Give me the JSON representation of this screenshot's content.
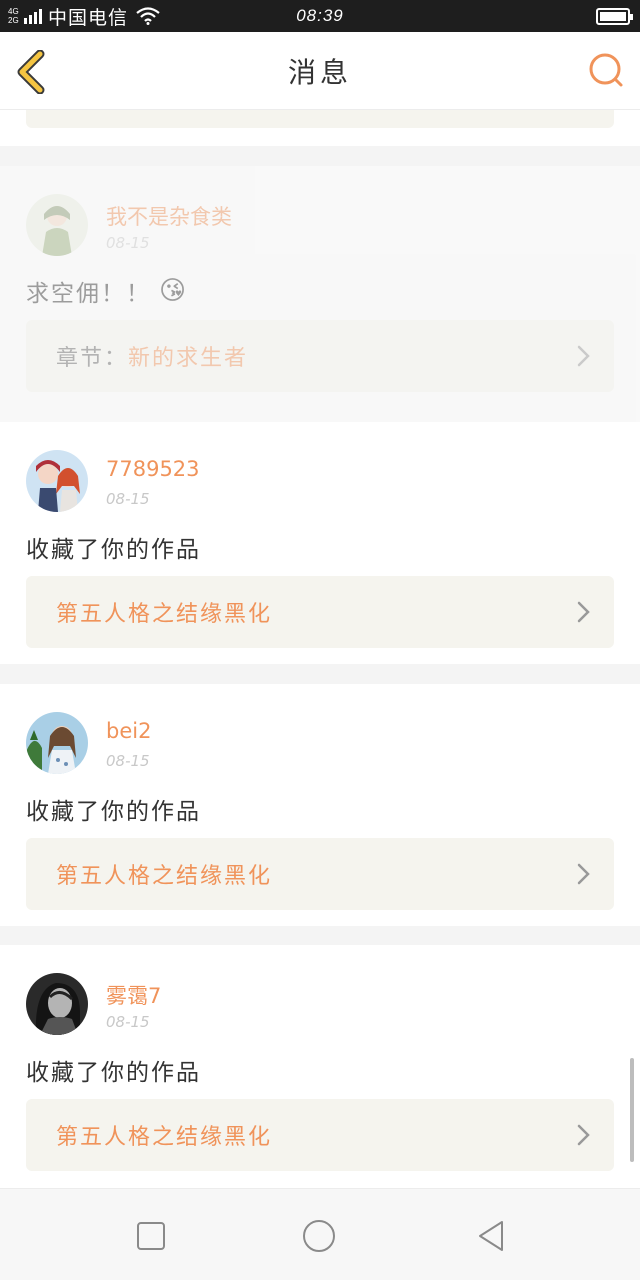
{
  "status_bar": {
    "network_top": "4G",
    "network_bottom": "2G",
    "carrier": "中国电信",
    "time": "08:39"
  },
  "header": {
    "title": "消息",
    "back_icon": "chevron-left-icon",
    "search_icon": "search-icon"
  },
  "colors": {
    "accent": "#f0935a",
    "back_arrow": "#f5c542",
    "link_bg": "#f5f4ee",
    "text": "#333333",
    "time": "#c8c8c8"
  },
  "cards": [
    {
      "username": "我不是杂食类",
      "time": "08-15",
      "message": "求空佣！！",
      "emoji": "😘",
      "link_prefix": "章节：",
      "link_title": "新的求生者"
    },
    {
      "username": "7789523",
      "time": "08-15",
      "message": "收藏了你的作品",
      "link_title": "第五人格之结缘黑化"
    },
    {
      "username": "bei2",
      "time": "08-15",
      "message": "收藏了你的作品",
      "link_title": "第五人格之结缘黑化"
    },
    {
      "username": "雾霭7",
      "time": "08-15",
      "message": "收藏了你的作品",
      "link_title": "第五人格之结缘黑化"
    }
  ],
  "nav_bar": {
    "icons": [
      "recent-apps-icon",
      "home-icon",
      "back-icon"
    ]
  }
}
